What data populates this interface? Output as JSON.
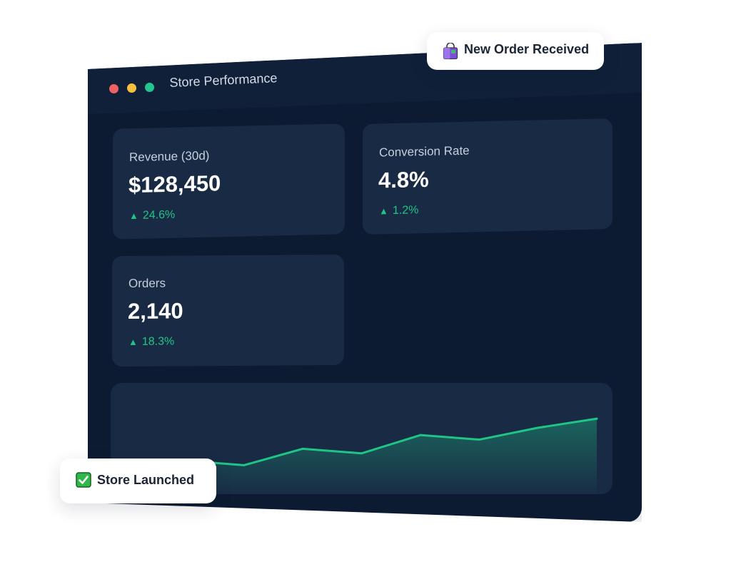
{
  "window": {
    "title": "Store Performance"
  },
  "cards": {
    "revenue": {
      "label": "Revenue (30d)",
      "value": "$128,450",
      "delta": "24.6%"
    },
    "conversion": {
      "label": "Conversion Rate",
      "value": "4.8%",
      "delta": "1.2%"
    },
    "orders": {
      "label": "Orders",
      "value": "2,140",
      "delta": "18.3%"
    }
  },
  "toasts": {
    "order": {
      "text": "New Order Received",
      "icon": "shopping-bag-icon"
    },
    "launch": {
      "text": "Store Launched",
      "icon": "check-box-icon"
    }
  },
  "colors": {
    "window_bg": "#0c1b31",
    "card_bg": "#182a44",
    "accent_green": "#1fc486",
    "traffic_red": "#f26161",
    "traffic_yellow": "#f5bf3f",
    "traffic_green": "#23c48e"
  },
  "chart_data": {
    "type": "area",
    "x": [
      1,
      2,
      3,
      4,
      5,
      6,
      7,
      8,
      9
    ],
    "values": [
      20,
      32,
      27,
      45,
      40,
      60,
      55,
      68,
      78
    ],
    "ylim": [
      0,
      100
    ],
    "title": "",
    "xlabel": "",
    "ylabel": "",
    "grid": false
  }
}
